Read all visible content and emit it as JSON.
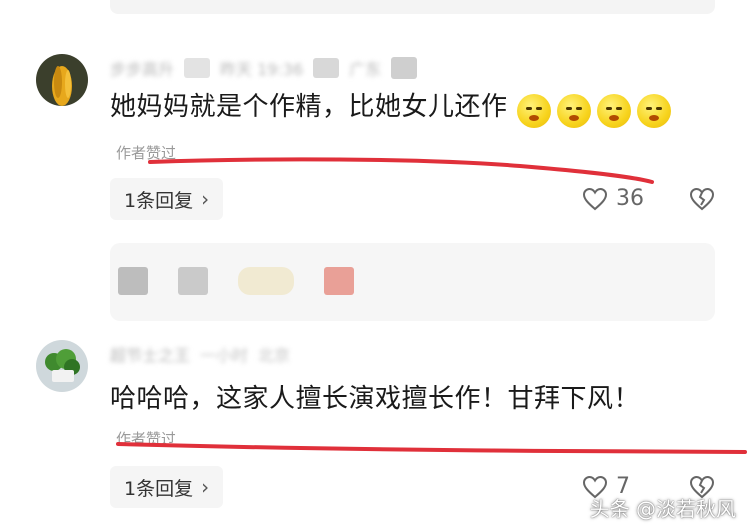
{
  "comments": [
    {
      "author_blurred": "步步高升",
      "time_blurred": "昨天 19:36",
      "location_blurred": "广东",
      "text": "她妈妈就是个作精，比她女儿还作",
      "emojis": [
        "grimace-emoji",
        "grimace-emoji",
        "grimace-emoji",
        "grimace-emoji"
      ],
      "author_liked": "作者赞过",
      "reply_label": "1条回复",
      "likes": "36"
    },
    {
      "author_blurred": "超节士之王",
      "time_blurred": "一小时",
      "location_blurred": "北京",
      "text": "哈哈哈，这家人擅长演戏擅长作！甘拜下风！",
      "author_liked": "作者赞过",
      "reply_label": "1条回复",
      "likes": "7"
    }
  ],
  "watermark": "头条 @淡若秋风",
  "colors": {
    "underline": "#e0303a",
    "reply_bg": "#f5f5f5",
    "meta_text": "#bbbbbb"
  }
}
